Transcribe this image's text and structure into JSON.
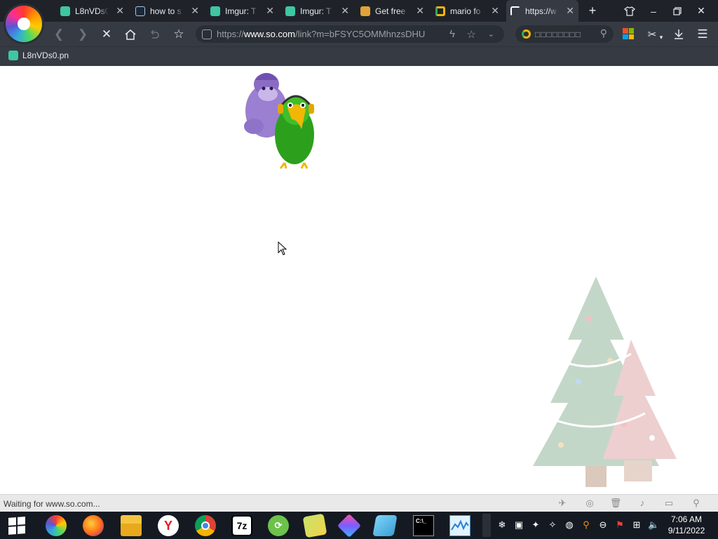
{
  "tabs": [
    {
      "title": "L8nVDs0",
      "favicon": "imgur-icon"
    },
    {
      "title": "how to s",
      "favicon": "steam-icon"
    },
    {
      "title": "Imgur: T",
      "favicon": "imgur-icon"
    },
    {
      "title": "Imgur: T",
      "favicon": "imgur-icon"
    },
    {
      "title": "Get free",
      "favicon": "gift-icon"
    },
    {
      "title": "mario fo",
      "favicon": "search-engine-icon"
    },
    {
      "title": "https://w",
      "favicon": "loading-icon",
      "active": true
    }
  ],
  "address_bar": {
    "prefix": "https://",
    "domain": "www.so.com",
    "path": "/link?m=bFSYC5OMMhnzsDHU"
  },
  "search_box": {
    "placeholder": "□□□□□□□□"
  },
  "bookmarks": [
    {
      "label": "L8nVDs0.pn"
    }
  ],
  "status": {
    "text": "Waiting for www.so.com..."
  },
  "taskbar": {
    "apps": [
      "browser-360",
      "firefox",
      "file-explorer",
      "yandex-browser",
      "chrome",
      "7-zip",
      "app-green",
      "app-folder-yellow",
      "app-purple-gem",
      "app-notepad",
      "command-prompt",
      "resource-monitor"
    ]
  },
  "clock": {
    "time": "7:06 AM",
    "date": "9/11/2022"
  },
  "colors": {
    "titlebar": "#1f2329",
    "toolbar": "#363b43",
    "taskbar": "#151a22",
    "page": "#ffffff"
  }
}
